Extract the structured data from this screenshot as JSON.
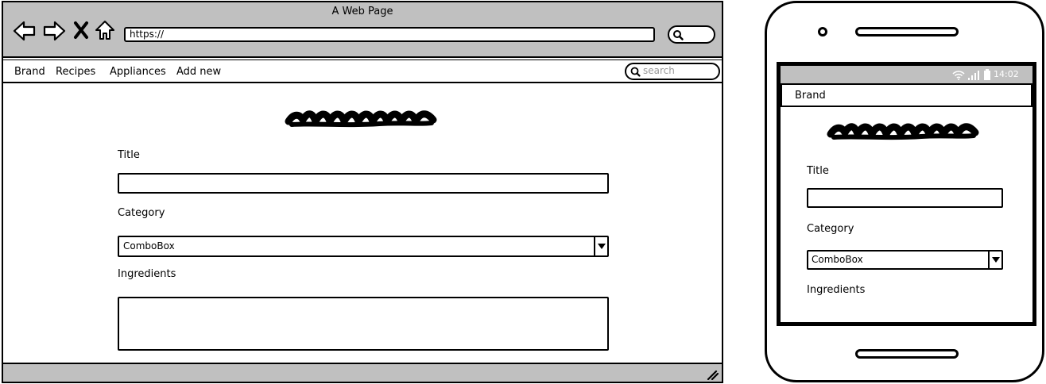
{
  "browser": {
    "title": "A Web Page",
    "url": "https://",
    "nav_icons": [
      "back-arrow-icon",
      "forward-arrow-icon",
      "close-x-icon",
      "home-icon"
    ],
    "search_icon": "search-icon",
    "menu": [
      "Brand",
      "Recipes",
      "Appliances",
      "Add new"
    ],
    "search_placeholder": "search",
    "resize_icon": "resize-grip-icon"
  },
  "form": {
    "title_label": "Title",
    "title_value": "",
    "category_label": "Category",
    "category_value": "ComboBox",
    "ingredients_label": "Ingredients",
    "ingredients_value": ""
  },
  "phone": {
    "status_time": "14:02",
    "status_icons": [
      "wifi-icon",
      "signal-icon",
      "battery-icon"
    ],
    "nav_brand": "Brand",
    "title_label": "Title",
    "category_label": "Category",
    "category_value": "ComboBox",
    "ingredients_label": "Ingredients"
  },
  "colors": {
    "chrome_gray": "#c0c0c0",
    "ink": "#000000",
    "paper": "#ffffff"
  }
}
